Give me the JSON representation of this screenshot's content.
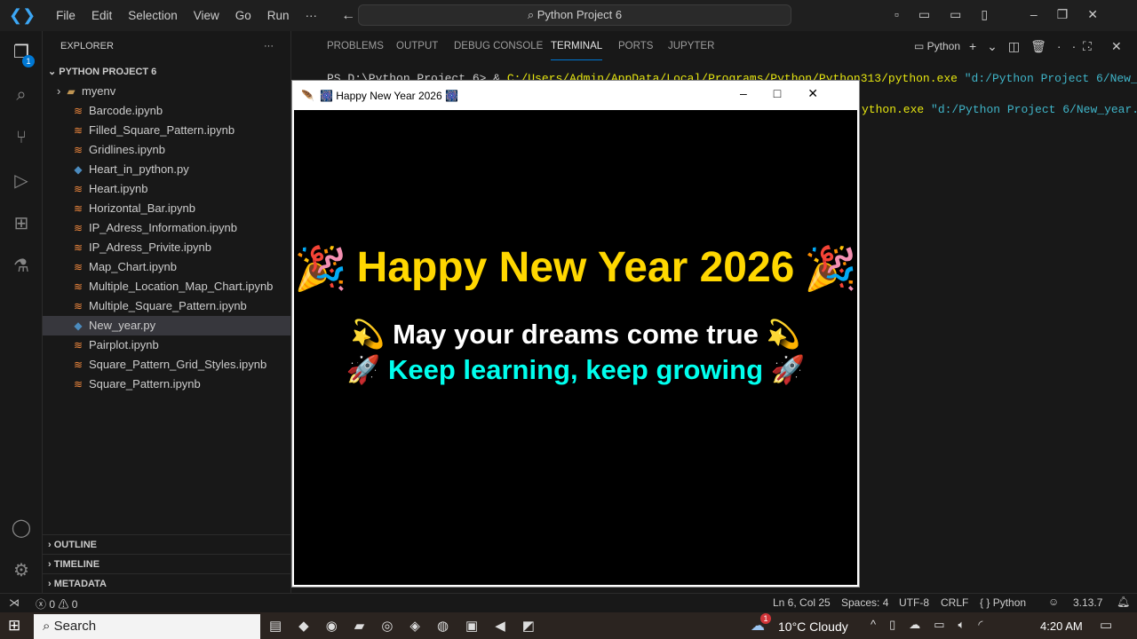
{
  "titlebar": {
    "menus": [
      "File",
      "Edit",
      "Selection",
      "View",
      "Go",
      "Run",
      "···"
    ],
    "search": "Python Project 6"
  },
  "explorer": {
    "header": "EXPLORER",
    "project": "PYTHON PROJECT 6",
    "folder": "myenv",
    "files": [
      "Barcode.ipynb",
      "Filled_Square_Pattern.ipynb",
      "Gridlines.ipynb",
      "Heart_in_python.py",
      "Heart.ipynb",
      "Horizontal_Bar.ipynb",
      "IP_Adress_Information.ipynb",
      "IP_Adress_Privite.ipynb",
      "Map_Chart.ipynb",
      "Multiple_Location_Map_Chart.ipynb",
      "Multiple_Square_Pattern.ipynb",
      "New_year.py",
      "Pairplot.ipynb",
      "Square_Pattern_Grid_Styles.ipynb",
      "Square_Pattern.ipynb"
    ],
    "sections": [
      "OUTLINE",
      "TIMELINE",
      "METADATA"
    ],
    "badge": "1"
  },
  "panel": {
    "tabs": [
      "PROBLEMS",
      "OUTPUT",
      "DEBUG CONSOLE",
      "TERMINAL",
      "PORTS",
      "JUPYTER"
    ],
    "shell": "Python",
    "prompt": "PS D:\\Python Project 6> & ",
    "exe": "C:/Users/Admin/AppData/Local/Programs/Python/Python313/python.exe",
    "arg": "\"d:/Python Project 6/New_year.",
    "line2_exe": "ython.exe"
  },
  "tk": {
    "title": "🎆 Happy New Year 2026 🎆",
    "headline": "Happy New Year 2026",
    "line1": "May your dreams come true",
    "line2": "Keep learning, keep growing",
    "colors": {
      "headline": "#ffd700",
      "line1": "#ffffff",
      "line2": "#00ffee"
    }
  },
  "status": {
    "errors": "0",
    "warnings": "0",
    "position": "Ln 6, Col 25",
    "spaces": "Spaces: 4",
    "encoding": "UTF-8",
    "eol": "CRLF",
    "language": "Python",
    "version": "3.13.7"
  },
  "taskbar": {
    "search": "Search",
    "weather": "10°C  Cloudy",
    "weather_badge": "1",
    "time": "4:20 AM"
  }
}
